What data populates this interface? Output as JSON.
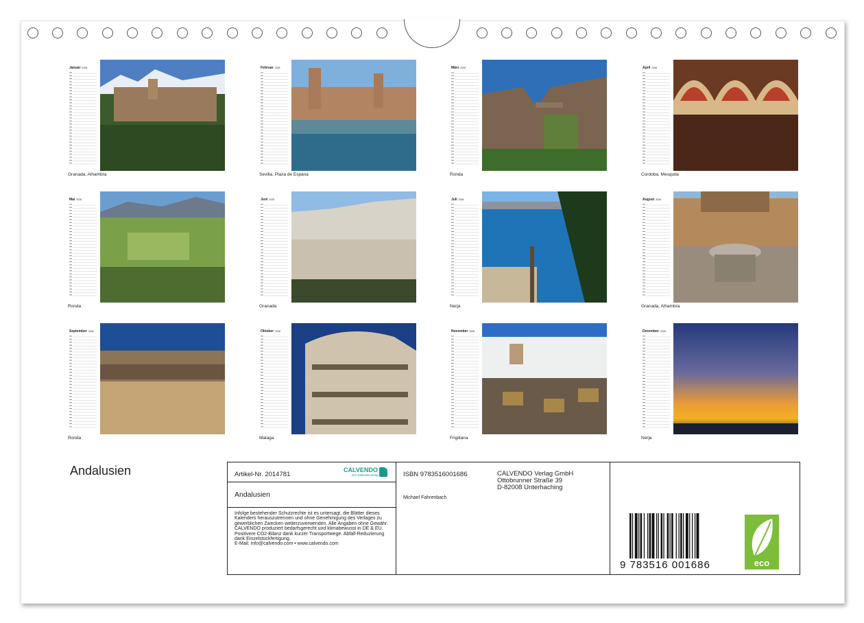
{
  "months": [
    {
      "name": "Januar",
      "year": "2026",
      "caption": "Granada, Alhambra"
    },
    {
      "name": "Februar",
      "year": "2026",
      "caption": "Sevilla, Plaza de Espana"
    },
    {
      "name": "März",
      "year": "2026",
      "caption": "Ronda"
    },
    {
      "name": "April",
      "year": "2026",
      "caption": "Cordoba, Mesquita"
    },
    {
      "name": "Mai",
      "year": "2026",
      "caption": "Ronda"
    },
    {
      "name": "Juni",
      "year": "2026",
      "caption": "Granada"
    },
    {
      "name": "Juli",
      "year": "2026",
      "caption": "Nerja"
    },
    {
      "name": "August",
      "year": "2026",
      "caption": "Granada, Alhambra"
    },
    {
      "name": "September",
      "year": "2026",
      "caption": "Ronda"
    },
    {
      "name": "Oktober",
      "year": "2026",
      "caption": "Malaga"
    },
    {
      "name": "November",
      "year": "2026",
      "caption": "Frigiliana"
    },
    {
      "name": "Dezember",
      "year": "2026",
      "caption": "Nerja"
    }
  ],
  "title": "Andalusien",
  "info": {
    "article": "Artikel-Nr. 2014781",
    "logo": "CALVENDO",
    "logo_sub": "Der Kalenderverlag",
    "title": "Andalusien",
    "isbn": "ISBN 9783516001686",
    "author": "Michael Fahrenbach",
    "publisher_name": "CALVENDO Verlag GmbH",
    "publisher_street": "Ottobrunner Straße 39",
    "publisher_city": "D-82008 Unterhaching",
    "legal": "Infolge bestehender Schutzrechte ist es untersagt, die Blätter dieses Kalenders herauszutrennen und ohne Genehmigung des Verlages zu gewerblichen Zwecken weiterzuverwenden. Alle Angaben ohne Gewähr.",
    "eco_text": "CALVENDO produziert bedarfsgerecht und klimabewusst in DE & EU. Positivere CO2-Bilanz dank kurzer Transportwege. Abfall-Reduzierung dank Einzelstückfertigung.",
    "contact": "E-Mail: info@calvendo.com • www.calvendo.com",
    "barcode_digits": "9 783516 001686",
    "eco_label": "eco"
  },
  "colors": {
    "eco_green": "#7cbd3a",
    "calvendo_teal": "#1a9a8a"
  }
}
